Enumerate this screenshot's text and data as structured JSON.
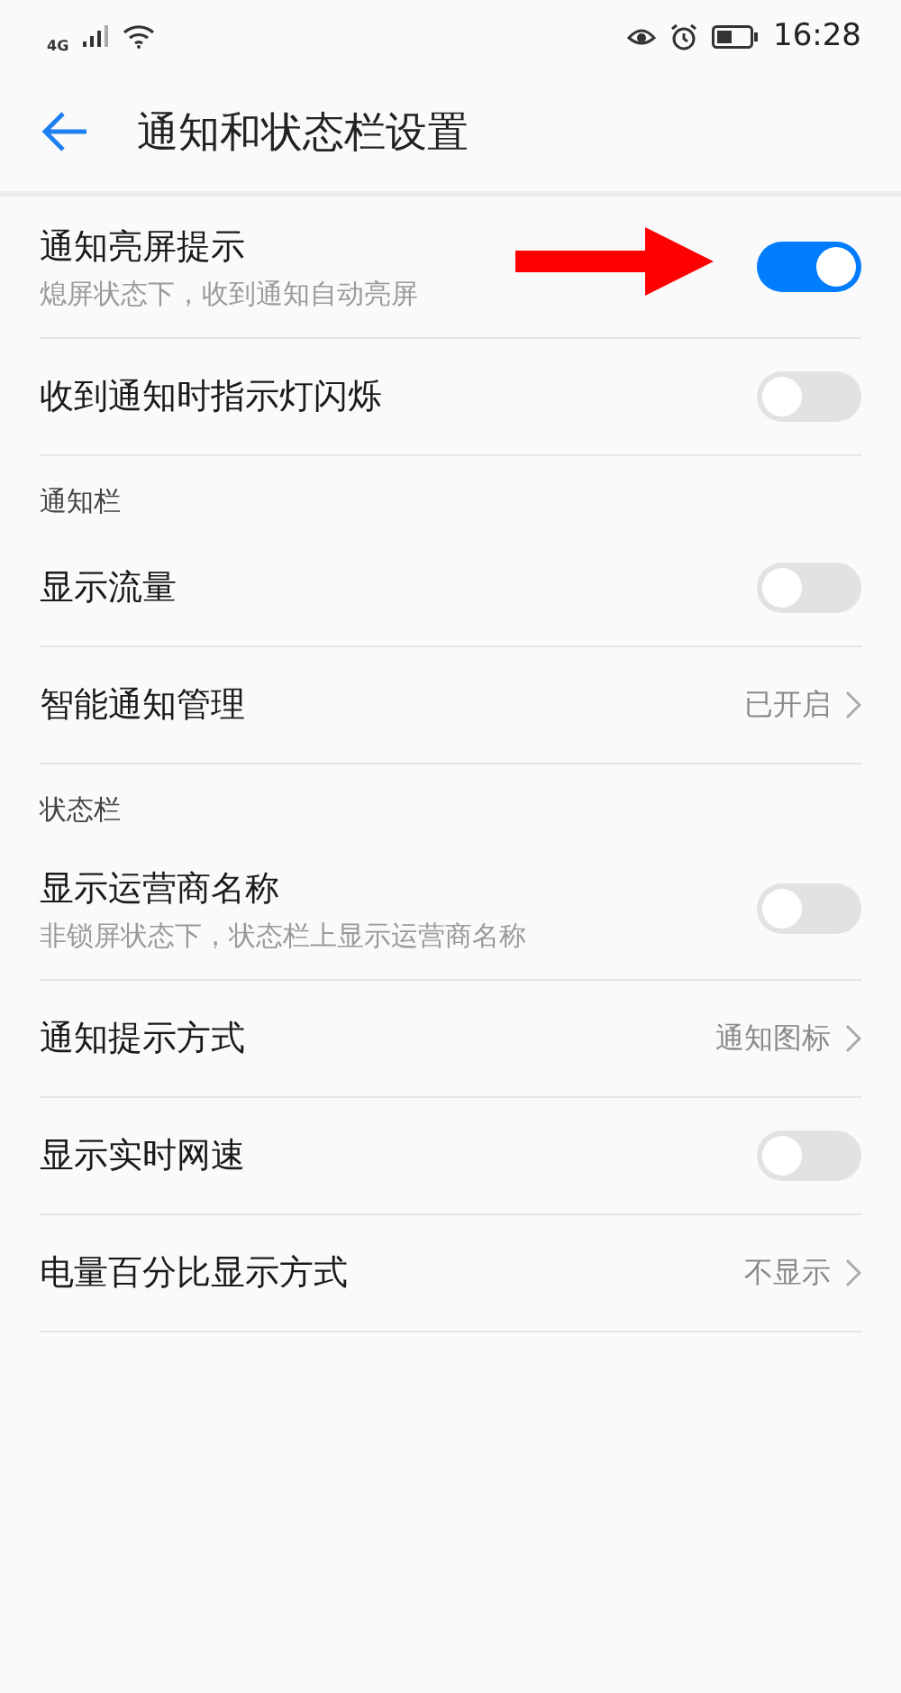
{
  "status_bar": {
    "network": "4G",
    "time": "16:28"
  },
  "header": {
    "title": "通知和状态栏设置"
  },
  "sections": [
    {
      "items": [
        {
          "kind": "toggle",
          "label": "通知亮屏提示",
          "subtitle": "熄屏状态下，收到通知自动亮屏",
          "on": true,
          "highlighted": true
        },
        {
          "kind": "toggle",
          "label": "收到通知时指示灯闪烁",
          "on": false
        }
      ]
    },
    {
      "title": "通知栏",
      "items": [
        {
          "kind": "toggle",
          "label": "显示流量",
          "on": false
        },
        {
          "kind": "link",
          "label": "智能通知管理",
          "value": "已开启"
        }
      ]
    },
    {
      "title": "状态栏",
      "items": [
        {
          "kind": "toggle",
          "label": "显示运营商名称",
          "subtitle": "非锁屏状态下，状态栏上显示运营商名称",
          "on": false
        },
        {
          "kind": "link",
          "label": "通知提示方式",
          "value": "通知图标"
        },
        {
          "kind": "toggle",
          "label": "显示实时网速",
          "on": false
        },
        {
          "kind": "link",
          "label": "电量百分比显示方式",
          "value": "不显示"
        }
      ]
    }
  ]
}
